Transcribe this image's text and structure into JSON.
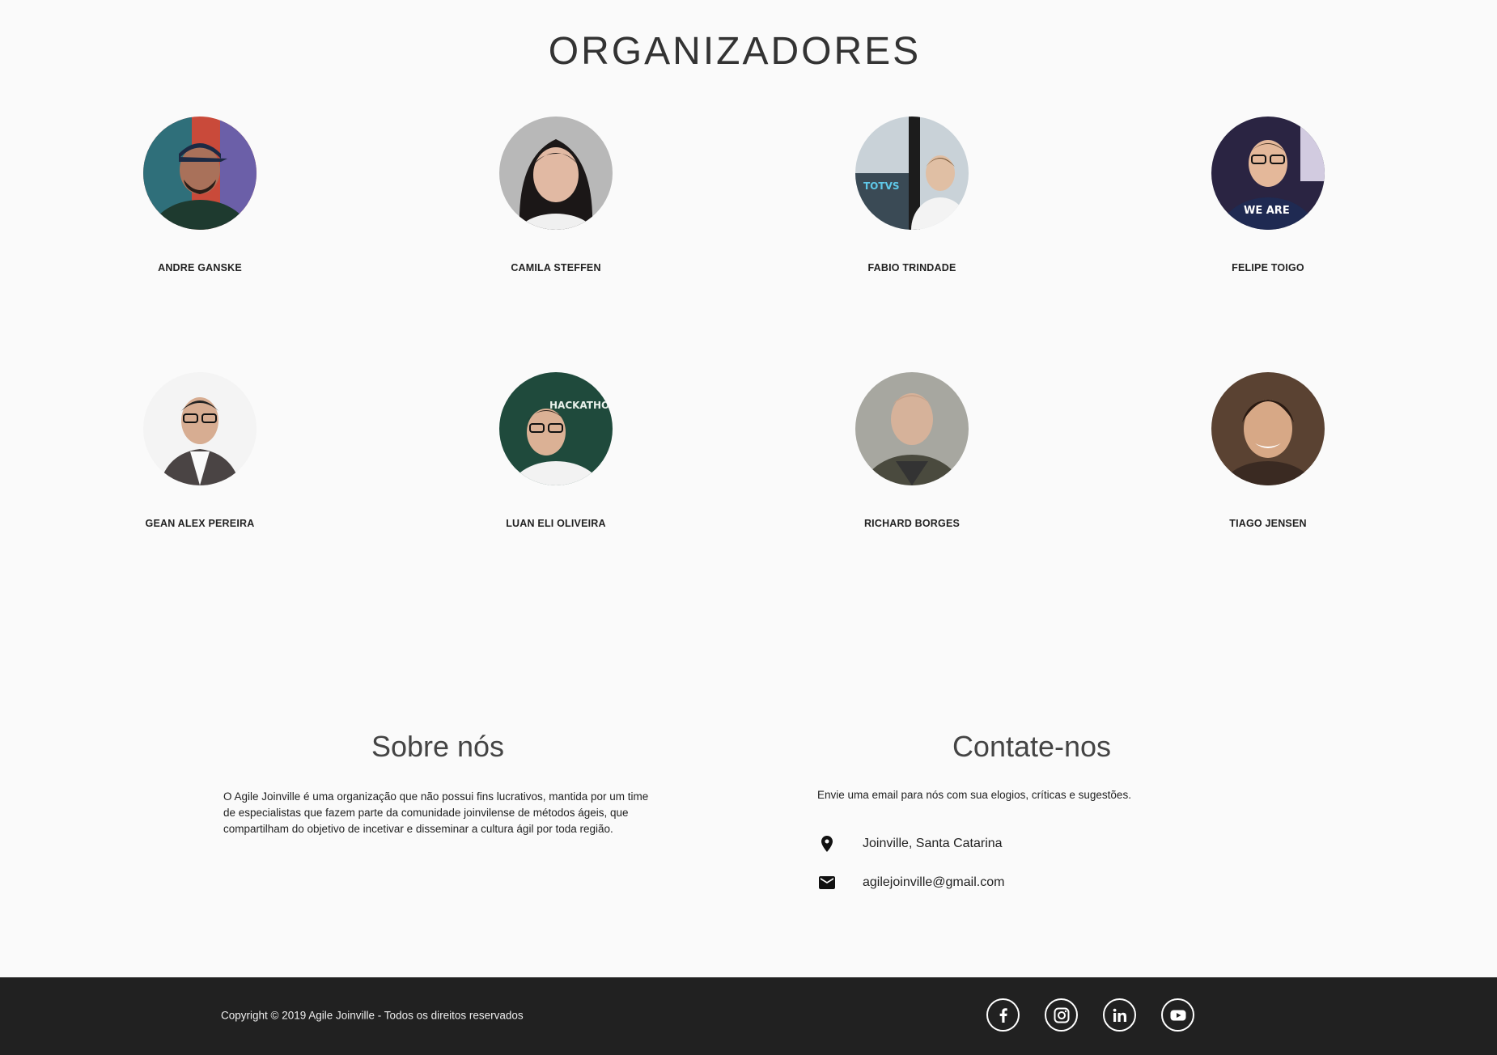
{
  "organizers_section": {
    "title": "ORGANIZADORES",
    "people": [
      {
        "name": "ANDRE GANSKE"
      },
      {
        "name": "CAMILA STEFFEN"
      },
      {
        "name": "FABIO TRINDADE"
      },
      {
        "name": "FELIPE TOIGO"
      },
      {
        "name": "GEAN ALEX PEREIRA"
      },
      {
        "name": "LUAN ELI OLIVEIRA"
      },
      {
        "name": "RICHARD BORGES"
      },
      {
        "name": "TIAGO JENSEN"
      }
    ]
  },
  "about": {
    "title": "Sobre nós",
    "text": "O Agile Joinville é uma organização que não possui fins lucrativos, mantida por um time de especialistas que fazem parte da comunidade joinvilense de métodos ágeis, que compartilham do objetivo de incetivar e disseminar a cultura ágil por toda região."
  },
  "contact": {
    "title": "Contate-nos",
    "intro": "Envie uma email para nós com sua elogios, críticas e sugestões.",
    "location": "Joinville, Santa Catarina",
    "email": "agilejoinville@gmail.com",
    "location_icon": "map-pin-icon",
    "email_icon": "mail-icon"
  },
  "footer": {
    "copyright": "Copyright © 2019 Agile Joinville - Todos os direitos reservados",
    "social": [
      "facebook-icon",
      "instagram-icon",
      "linkedin-icon",
      "youtube-icon"
    ],
    "background": "#212121"
  },
  "colors": {
    "page_background": "#fafafa",
    "text": "#222222"
  }
}
